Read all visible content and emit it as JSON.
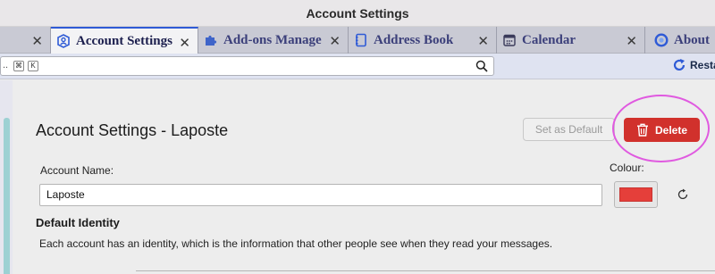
{
  "window": {
    "title": "Account Settings"
  },
  "tabs": [
    {
      "label": "",
      "icon": "blank-tab-icon",
      "active": false
    },
    {
      "label": "Account Settings",
      "icon": "account-settings-icon",
      "active": true
    },
    {
      "label": "Add-ons Manager",
      "icon": "puzzle-icon",
      "active": false
    },
    {
      "label": "Address Book",
      "icon": "address-book-icon",
      "active": false
    },
    {
      "label": "Calendar",
      "icon": "calendar-icon",
      "active": false
    },
    {
      "label": "About",
      "icon": "about-icon",
      "active": false
    }
  ],
  "toolbar": {
    "search_placeholder": "..",
    "shortcut_keys": [
      "⌘",
      "K"
    ],
    "restart_label": "Resta"
  },
  "account": {
    "heading": "Account Settings - Laposte",
    "set_default_label": "Set as Default",
    "delete_label": "Delete",
    "name_label": "Account Name:",
    "name_value": "Laposte",
    "colour_label": "Colour:",
    "colour_value": "#e53f3a",
    "default_identity_title": "Default Identity",
    "identity_description": "Each account has an identity, which is the information that other people see when they read your messages."
  },
  "colors": {
    "accent": "#2f5bd6",
    "delete": "#d1312c",
    "annotation_ring": "#e05ae0"
  }
}
